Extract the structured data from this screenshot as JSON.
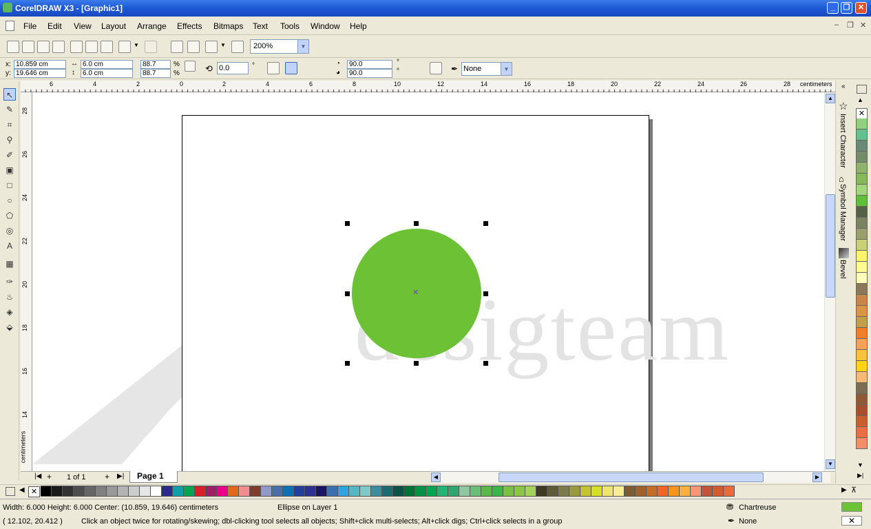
{
  "window": {
    "title": "CorelDRAW X3 - [Graphic1]"
  },
  "menu": [
    "File",
    "Edit",
    "View",
    "Layout",
    "Arrange",
    "Effects",
    "Bitmaps",
    "Text",
    "Tools",
    "Window",
    "Help"
  ],
  "toolbar": {
    "zoom": "200%"
  },
  "property_bar": {
    "x_label": "x:",
    "x_value": "10.859 cm",
    "y_label": "y:",
    "y_value": "19.646 cm",
    "width_value": "6.0 cm",
    "height_value": "6.0 cm",
    "scale_x": "88.7",
    "scale_y": "88.7",
    "percent": "%",
    "rotation": "0.0",
    "degree": "°",
    "start_angle": "90.0",
    "end_angle": "90.0",
    "outline_width": "None"
  },
  "ruler": {
    "top_ticks": [
      "6",
      "4",
      "2",
      "0",
      "2",
      "4",
      "6",
      "8",
      "10",
      "12",
      "14",
      "16",
      "18",
      "20",
      "22",
      "24",
      "26",
      "28"
    ],
    "top_unit": "centimeters",
    "left_ticks": [
      "28",
      "26",
      "24",
      "22",
      "20",
      "18",
      "16",
      "14"
    ],
    "left_unit": "centimeters"
  },
  "canvas": {
    "watermark": "desigteam",
    "object_color": "#6cc135"
  },
  "page_nav": {
    "count": "1 of 1",
    "page_tab": "Page 1"
  },
  "dockers": [
    "Insert Character",
    "Symbol Manager",
    "Bevel"
  ],
  "palette_vertical": [
    "#8fd17e",
    "#66c08d",
    "#6b8a75",
    "#748d69",
    "#8fb26f",
    "#86b85c",
    "#a3d47e",
    "#5fbf3a",
    "#556147",
    "#7b8460",
    "#99a06d",
    "#cad07a",
    "#fff46b",
    "#fffb94",
    "#fffcba",
    "#8b7959",
    "#c9864a",
    "#d79545",
    "#c39e4f",
    "#f07f2b",
    "#f4a15a",
    "#f8c23b",
    "#ffd317",
    "#f6b97a",
    "#7a6d52",
    "#8e5a38",
    "#a5502f",
    "#c6612f",
    "#e86e48",
    "#f28f6a"
  ],
  "palette_bottom": [
    "#000000",
    "#1a1a1a",
    "#333333",
    "#4d4d4d",
    "#666666",
    "#808080",
    "#999999",
    "#b3b3b3",
    "#cccccc",
    "#e6e6e6",
    "#ffffff",
    "#2b2a8a",
    "#0f9fa6",
    "#00a651",
    "#d72027",
    "#9e1f63",
    "#ec008c",
    "#e2681b",
    "#f28d8d",
    "#7d3f2b",
    "#8f9ac8",
    "#4a6ea8",
    "#0b71b7",
    "#22409a",
    "#2e3192",
    "#1b1464",
    "#3a6fb0",
    "#2ba6de",
    "#55b7c6",
    "#7fc9c9",
    "#3c8e9f",
    "#1d6d70",
    "#0b5345",
    "#007236",
    "#009245",
    "#00a651",
    "#22b573",
    "#2fa66e",
    "#8cc9a1",
    "#6bbf74",
    "#58b947",
    "#39b54a",
    "#7ac143",
    "#8dc63f",
    "#a6d15a",
    "#3f3a25",
    "#5e5a3a",
    "#7d7a4b",
    "#99993e",
    "#c4c431",
    "#d7df23",
    "#eee66b",
    "#f9ef90",
    "#7f5b34",
    "#a0622d",
    "#c46d29",
    "#f26522",
    "#f7941d",
    "#fbb040",
    "#f69679",
    "#c1543a",
    "#d45b2e",
    "#e96b3c"
  ],
  "status": {
    "dimensions": "Width: 6.000  Height: 6.000  Center: (10.859, 19.646)  centimeters",
    "object_info": "Ellipse on Layer 1",
    "cursor": "( 12.102, 20.412 )",
    "hint": "Click an object twice for rotating/skewing; dbl-clicking tool selects all objects; Shift+click multi-selects; Alt+click digs; Ctrl+click selects in a group",
    "fill_name": "Chartreuse",
    "fill_color": "#6cc135",
    "outline_name": "None"
  }
}
